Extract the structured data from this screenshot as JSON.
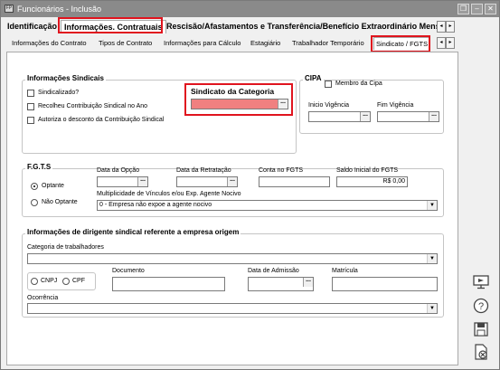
{
  "window": {
    "app_icon": "FP",
    "title": "Funcionários - Inclusão",
    "btn_restore": "❐",
    "btn_minimize": "–",
    "btn_close": "✕"
  },
  "tabs_main": [
    "Identificação",
    "Informações. Contratuais",
    "Rescisão/Afastamentos e Transferência/Benefício Extraordinário Mensal"
  ],
  "tabs_sub": [
    "Informações do Contrato",
    "Tipos de Contrato",
    "Informações para Cálculo",
    "Estagiário",
    "Trabalhador Temporário",
    "Sindicato / FGTS"
  ],
  "arrows": {
    "left": "◂",
    "right": "▸"
  },
  "sindicais": {
    "title": "Informações Sindicais",
    "sindicalizado": "Sindicalizado?",
    "recolheu": "Recolheu Contribuição Sindical no Ano",
    "autoriza": "Autoriza o desconto da Contribuição Sindical",
    "categoria_label": "Sindicato da Categoria",
    "categoria_value": ""
  },
  "cipa": {
    "title": "CIPA",
    "membro": "Membro da Cipa",
    "inicio_label": "Inicio Vigência",
    "fim_label": "Fim Vigência"
  },
  "fgts": {
    "title": "F.G.T.S",
    "optante": "Optante",
    "nao_optante": "Não Optante",
    "data_opcao": "Data da Opção",
    "data_retratacao": "Data da Retratação",
    "conta": "Conta no  FGTS",
    "saldo_label": "Saldo Inicial do FGTS",
    "saldo_value": "R$ 0,00",
    "multiplicidade_label": "Multiplicidade de Vínculos e/ou Exp. Agente Nocivo",
    "multiplicidade_value": "0 - Empresa não expoe a agente nocivo"
  },
  "dirigente": {
    "title": "Informações de dirigente sindical referente a empresa origem",
    "categoria_label": "Categoria de trabalhadores",
    "cnpj": "CNPJ",
    "cpf": "CPF",
    "documento_label": "Documento",
    "admissao_label": "Data de Admissão",
    "matricula_label": "Matrícula",
    "ocorrencia_label": "Ocorrência"
  },
  "buttons": {
    "dots": "...",
    "dropdown": "▼"
  },
  "icons": [
    "monitor-icon",
    "help-icon",
    "save-icon",
    "cancel-icon"
  ]
}
